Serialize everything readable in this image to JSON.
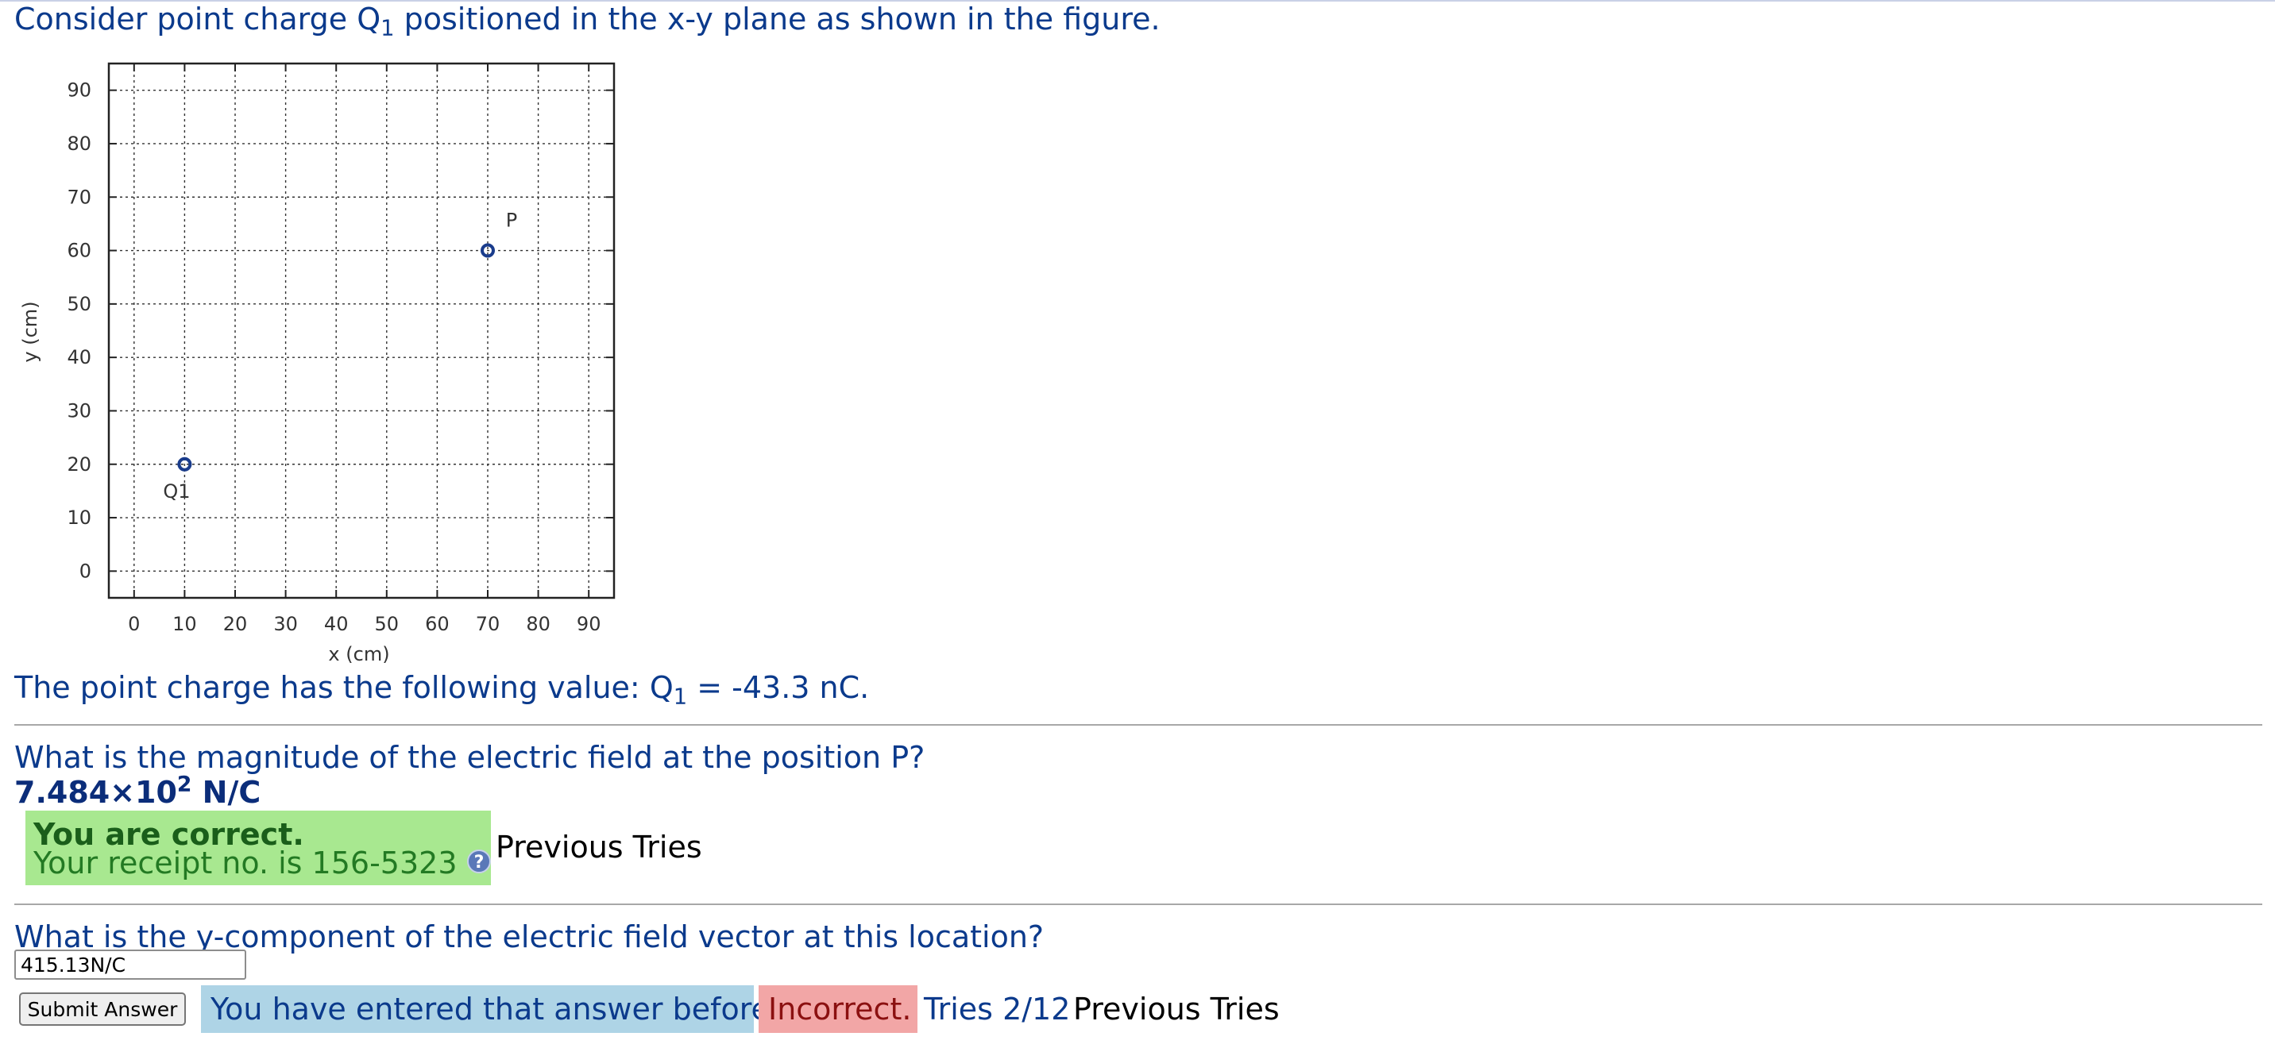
{
  "intro": {
    "before": "Consider point charge Q",
    "sub": "1",
    "after": " positioned in the x-y plane as shown in the figure."
  },
  "chart_data": {
    "type": "scatter",
    "xlabel": "x (cm)",
    "ylabel": "y (cm)",
    "xlim": [
      -5,
      95
    ],
    "ylim": [
      -5,
      95
    ],
    "x_ticks": [
      0,
      10,
      20,
      30,
      40,
      50,
      60,
      70,
      80,
      90
    ],
    "y_ticks": [
      0,
      10,
      20,
      30,
      40,
      50,
      60,
      70,
      80,
      90
    ],
    "grid": true,
    "points": [
      {
        "label": "Q1",
        "x": 10,
        "y": 20
      },
      {
        "label": "P",
        "x": 70,
        "y": 60
      }
    ],
    "marker_color": "#1a3c8c"
  },
  "charge_line": {
    "before": "The point charge has the following value: Q",
    "sub": "1",
    "after": " = -43.3 nC."
  },
  "question1": {
    "text": "What is the magnitude of the electric field at the position P?",
    "answer_mantissa": "7.484×10",
    "answer_exponent": "2",
    "answer_unit": " N/C",
    "status_title": "You are correct.",
    "receipt": "Your receipt no. is 156-5323",
    "help_icon": "?",
    "previous_tries": "Previous Tries"
  },
  "question2": {
    "text": "What is the y-component of the electric field vector at this location?",
    "input_value": "415.13N/C",
    "submit_label": "Submit Answer",
    "entered_before": "You have entered that answer before",
    "incorrect": "Incorrect.",
    "tries": "Tries 2/12",
    "previous_tries": "Previous Tries"
  },
  "colors": {
    "text_blue": "#0b3a8c",
    "correct_bg": "#a8e890",
    "info_bg": "#aed4e6",
    "incorrect_bg": "#f2a6a6"
  }
}
